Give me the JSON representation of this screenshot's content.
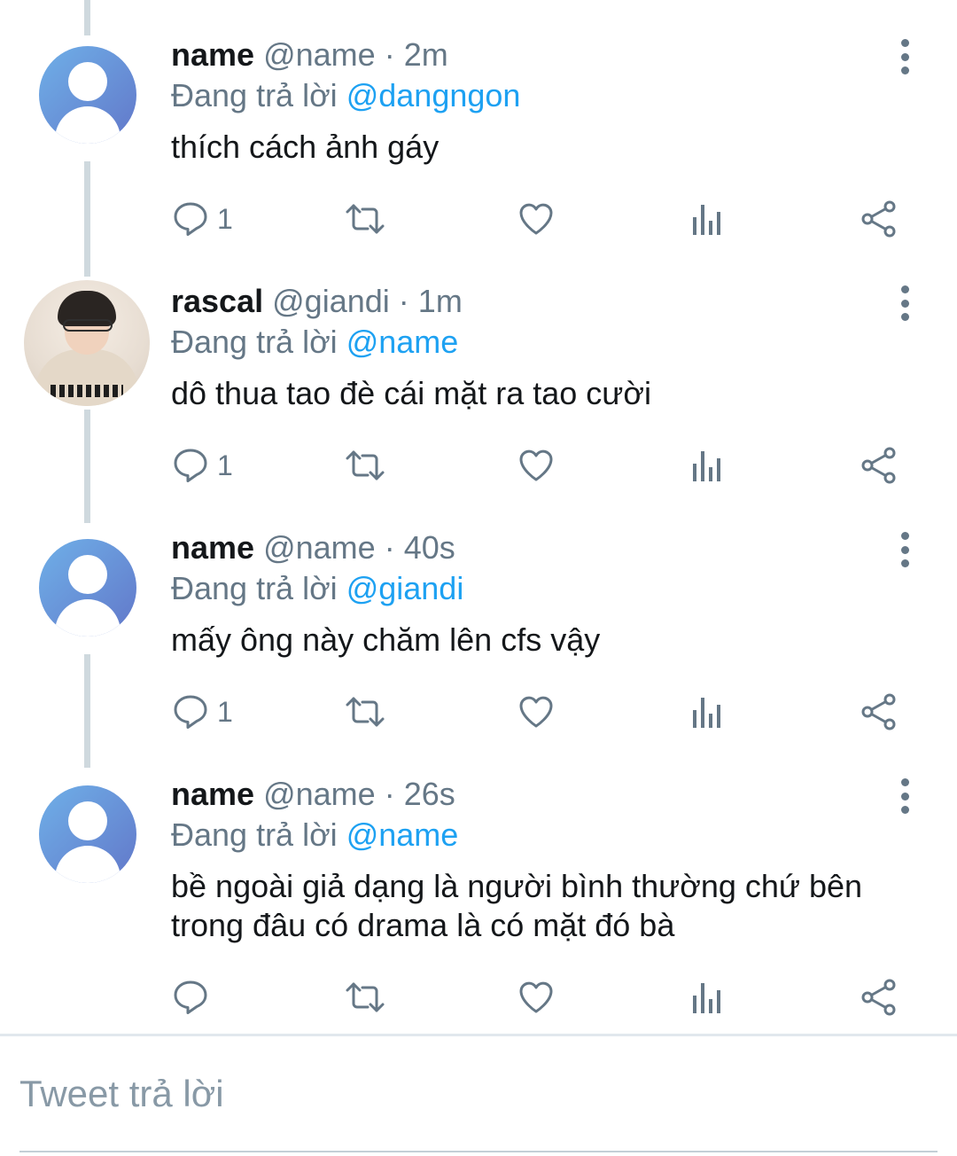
{
  "tweets": [
    {
      "name": "name",
      "handle": "@name",
      "time": "2m",
      "reply_prefix": "Đang trả lời",
      "reply_to": "@dangngon",
      "text": "thích cách ảnh gáy",
      "reply_count": "1",
      "avatar": "default-avatar"
    },
    {
      "name": "rascal",
      "handle": "@giandi",
      "time": "1m",
      "reply_prefix": "Đang trả lời",
      "reply_to": "@name",
      "text": "dô thua tao đè cái mặt ra tao cười",
      "reply_count": "1",
      "avatar": "photo-avatar"
    },
    {
      "name": "name",
      "handle": "@name",
      "time": "40s",
      "reply_prefix": "Đang trả lời",
      "reply_to": "@giandi",
      "text": "mấy ông này chăm lên cfs vậy",
      "reply_count": "1",
      "avatar": "default-avatar"
    },
    {
      "name": "name",
      "handle": "@name",
      "time": "26s",
      "reply_prefix": "Đang trả lời",
      "reply_to": "@name",
      "text": "bề ngoài giả dạng là người bình thường chứ bên trong đâu có drama là có mặt đó bà",
      "reply_count": "",
      "avatar": "default-avatar"
    }
  ],
  "separator": "·",
  "compose": {
    "placeholder": "Tweet trả lời"
  },
  "icons": [
    "reply-icon",
    "retweet-icon",
    "like-icon",
    "analytics-icon",
    "share-icon",
    "more-options-icon"
  ],
  "colors": {
    "accent": "#1da1f2",
    "muted": "#657786",
    "thread_line": "#cfd9de"
  }
}
